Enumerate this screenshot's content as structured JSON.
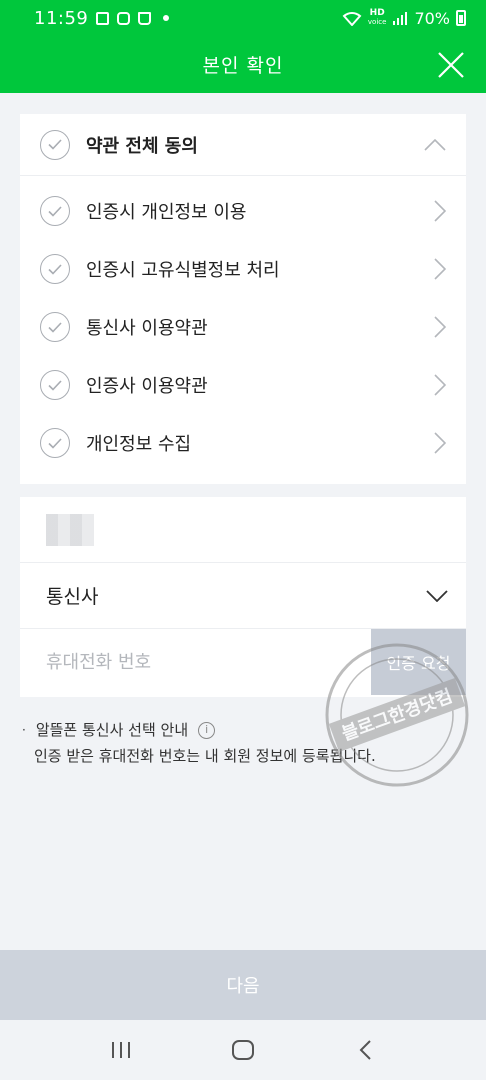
{
  "status_bar": {
    "time": "11:59",
    "battery": "70%",
    "network": "HD",
    "network_sub": "voice"
  },
  "header": {
    "title": "본인 확인",
    "background_color": "#00c73c"
  },
  "terms": {
    "all_label": "약관 전체 동의",
    "items": [
      {
        "label": "인증시 개인정보 이용"
      },
      {
        "label": "인증시 고유식별정보 처리"
      },
      {
        "label": "통신사 이용약관"
      },
      {
        "label": "인증사 이용약관"
      },
      {
        "label": "개인정보 수집"
      }
    ]
  },
  "form": {
    "carrier_label": "통신사",
    "phone_placeholder": "휴대전화 번호",
    "request_button": "인증 요청"
  },
  "notice": {
    "line1": "알뜰폰 통신사 선택 안내",
    "line2": "인증 받은 휴대전화 번호는 내 회원 정보에 등록됩니다."
  },
  "watermark": {
    "text": "블로그한경닷컴"
  },
  "footer": {
    "next_button": "다음"
  },
  "icons": {
    "check": "check-circle-icon",
    "chevron_right": "chevron-right-icon",
    "chevron_up": "chevron-up-icon",
    "chevron_down": "chevron-down-icon",
    "close": "close-icon",
    "info": "info-icon"
  }
}
